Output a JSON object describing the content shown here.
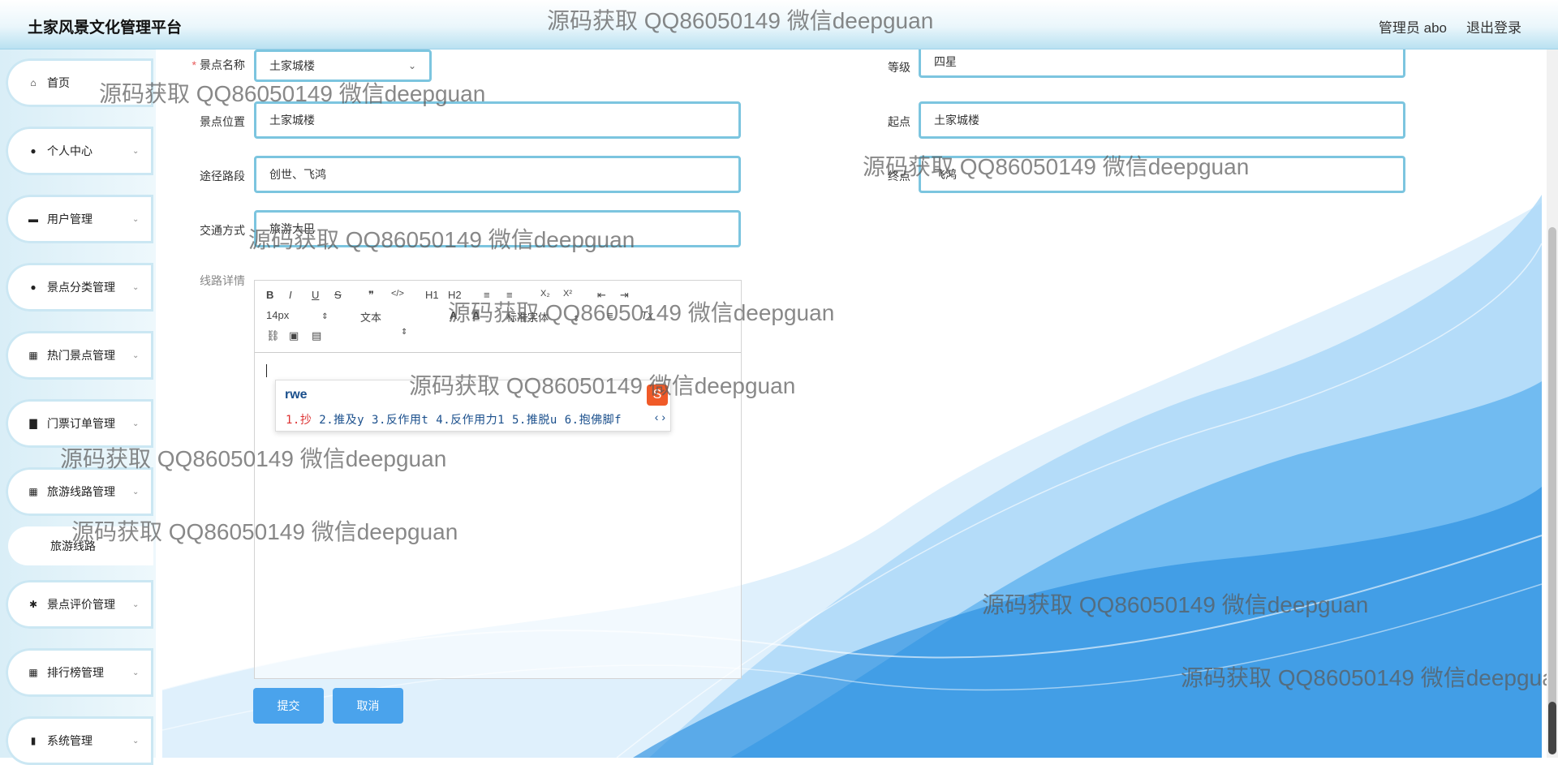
{
  "header": {
    "title": "土家风景文化管理平台",
    "user": "管理员 abo",
    "logout": "退出登录"
  },
  "sidebar": {
    "items": [
      {
        "label": "首页",
        "icon": "home-icon"
      },
      {
        "label": "个人中心",
        "icon": "user-icon"
      },
      {
        "label": "用户管理",
        "icon": "message-icon"
      },
      {
        "label": "景点分类管理",
        "icon": "user-icon"
      },
      {
        "label": "热门景点管理",
        "icon": "grid-icon"
      },
      {
        "label": "门票订单管理",
        "icon": "ticket-icon"
      },
      {
        "label": "旅游线路管理",
        "icon": "grid-icon"
      },
      {
        "label": "景点评价管理",
        "icon": "comment-icon"
      },
      {
        "label": "排行榜管理",
        "icon": "grid-icon"
      },
      {
        "label": "系统管理",
        "icon": "chart-icon"
      }
    ],
    "submenu": {
      "label": "旅游线路"
    }
  },
  "form": {
    "scenic_name": {
      "label": "景点名称",
      "value": "土家城楼"
    },
    "grade": {
      "label": "等级",
      "value": "四星"
    },
    "location": {
      "label": "景点位置",
      "value": "土家城楼"
    },
    "start": {
      "label": "起点",
      "value": "土家城楼"
    },
    "route": {
      "label": "途径路段",
      "value": "创世、飞鸿"
    },
    "end": {
      "label": "终点",
      "value": "飞鸿"
    },
    "transport": {
      "label": "交通方式",
      "value": "旅游大巴"
    },
    "detail": {
      "label": "线路详情"
    }
  },
  "editor": {
    "toolbar": {
      "bold": "B",
      "italic": "I",
      "underline": "U",
      "strike": "S",
      "quote": "❞",
      "code": "</>",
      "h1": "H1",
      "h2": "H2",
      "ol": "≡",
      "ul": "≡",
      "sub": "X₂",
      "sup": "X²",
      "outdent": "⇤",
      "indent": "⇥",
      "size": "14px",
      "header": "文本",
      "font": "标准字体",
      "align": "≡",
      "clean": "Tx",
      "link": "🔗",
      "image": "▣",
      "video": "▤"
    }
  },
  "ime": {
    "input": "rwe",
    "candidates": [
      "1.抄",
      "2.推及y",
      "3.反作用t",
      "4.反作用力1",
      "5.推脱u",
      "6.抱佛脚f"
    ],
    "arrows": "‹ ›"
  },
  "buttons": {
    "submit": "提交",
    "cancel": "取消"
  },
  "watermark": "源码获取 QQ86050149 微信deepguan",
  "colors": {
    "accent": "#4aa3ec",
    "field_border": "#7cc5df",
    "wave": "#2a8fe0"
  }
}
